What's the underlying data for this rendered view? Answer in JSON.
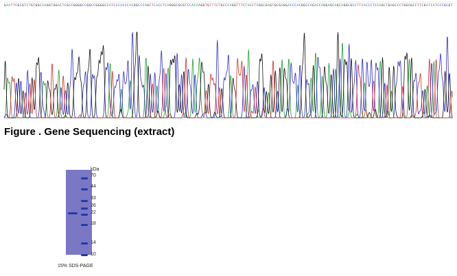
{
  "caption": "Figure . Gene Sequencing (extract)",
  "trace_colors": {
    "A": "#1f9e2c",
    "C": "#2a2ad0",
    "G": "#111111",
    "T": "#d12a2a"
  },
  "sequence": "GAATTCGCGTCTGTGGCAAGGTGGACTCGCCGGGGCCGGCCGGGGCCATCCCACCCACGGCCCAGCTCACCTCAGGGCGCGTCCACAAGGTGTTTCTGCCCAGGTTTCTACCTCGGCGAGTGCGAGGACCCACGGCCAGACCAGGAGCAGCAGGCGCCTTCACCCTCCAGCTGAGCCCTGGAGCCTTCGATCATCCCGCGT",
  "gel": {
    "unit": "kDa",
    "markers": [
      "70",
      "44",
      "33",
      "26",
      "22",
      "18",
      "14",
      "10"
    ],
    "caption": "15% SDS-PAGE"
  }
}
